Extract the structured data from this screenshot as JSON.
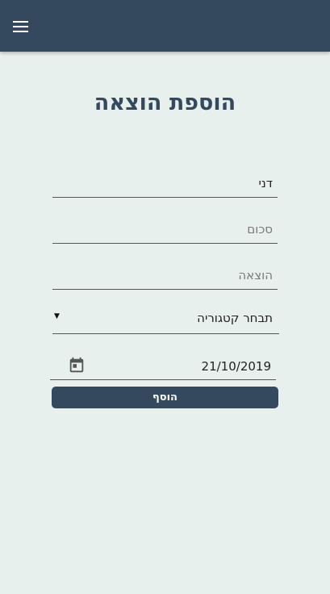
{
  "header": {
    "menu_icon": "hamburger-menu-icon",
    "bg_color": "#34495e"
  },
  "page": {
    "title": "הוספת הוצאה"
  },
  "form": {
    "name_value": "דני",
    "amount_placeholder": "סכום",
    "expense_placeholder": "הוצאה",
    "category_selected": "תבחר קטגוריה",
    "date_value": "21/10/2019",
    "calendar_icon": "calendar-icon",
    "submit_label": "הוסף"
  }
}
